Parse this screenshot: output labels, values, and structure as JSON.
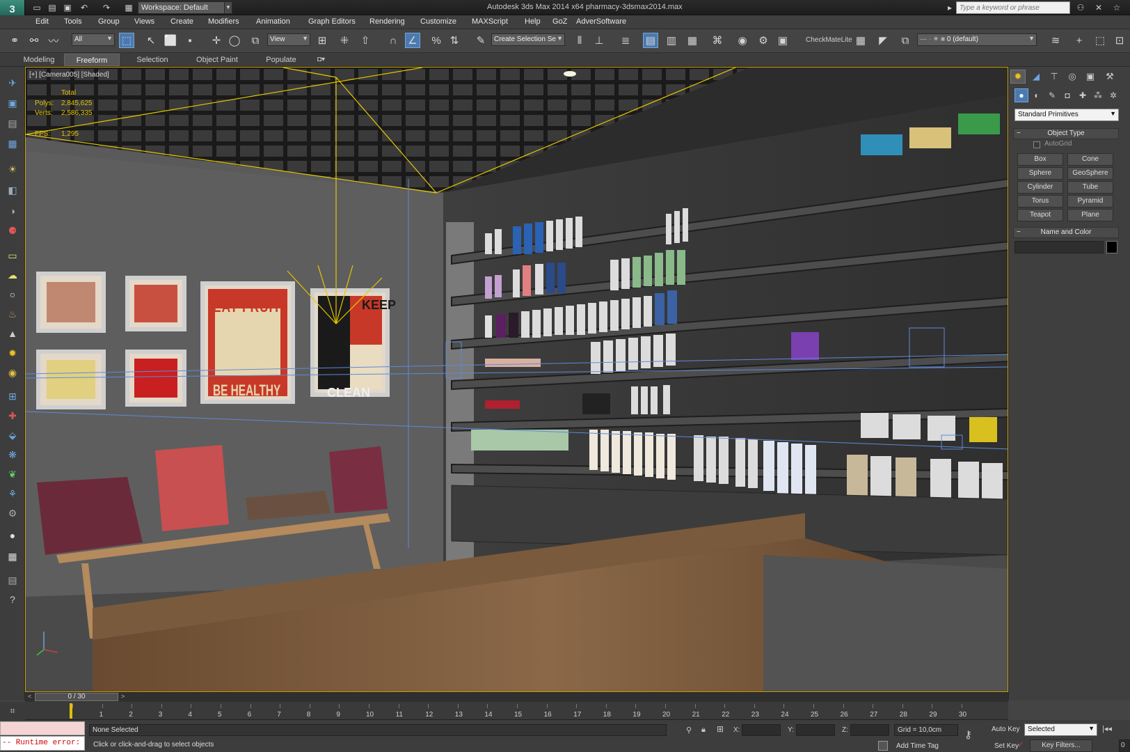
{
  "titlebar": {
    "app_title": "Autodesk 3ds Max  2014 x64      pharmacy-3dsmax2014.max",
    "workspace": "Workspace: Default",
    "search_placeholder": "Type a keyword or phrase"
  },
  "menus": [
    "Edit",
    "Tools",
    "Group",
    "Views",
    "Create",
    "Modifiers",
    "Animation",
    "Graph Editors",
    "Rendering",
    "Customize",
    "MAXScript",
    "Help",
    "GoZ",
    "AdverSoftware"
  ],
  "toolbar": {
    "selection_filter": "All",
    "ref_coord": "View",
    "named_selection": "Create Selection Se",
    "plugin_label": "CheckMateLite",
    "layer": "0 (default)"
  },
  "ribbon_tabs": [
    "Modeling",
    "Freeform",
    "Selection",
    "Object Paint",
    "Populate"
  ],
  "ribbon_active": "Freeform",
  "viewport": {
    "label": "[+] [Camera005] [Shaded]",
    "stats_header": "Total",
    "polys_label": "Polys:",
    "polys_value": "2,845,625",
    "verts_label": "Verts:",
    "verts_value": "2,586,335",
    "fps_label": "FPS:",
    "fps_value": "1,295",
    "poster_1": "EAT FRUIT",
    "poster_1b": "BE HEALTHY",
    "poster_2": "KEEP",
    "poster_2b": "CLEAN"
  },
  "command_panel": {
    "category": "Standard Primitives",
    "object_type_title": "Object Type",
    "autogrid": "AutoGrid",
    "primitives": [
      "Box",
      "Cone",
      "Sphere",
      "GeoSphere",
      "Cylinder",
      "Tube",
      "Torus",
      "Pyramid",
      "Teapot",
      "Plane"
    ],
    "name_color_title": "Name and Color"
  },
  "timeline": {
    "frame_display": "0 / 30",
    "ticks": [
      "0",
      "1",
      "2",
      "3",
      "4",
      "5",
      "6",
      "7",
      "8",
      "9",
      "10",
      "11",
      "12",
      "13",
      "14",
      "15",
      "16",
      "17",
      "18",
      "19",
      "20",
      "21",
      "22",
      "23",
      "24",
      "25",
      "26",
      "27",
      "28",
      "29",
      "30"
    ]
  },
  "status": {
    "runtime_error": "-- Runtime error:",
    "selection": "None Selected",
    "prompt": "Click or click-and-drag to select objects",
    "x_label": "X:",
    "y_label": "Y:",
    "z_label": "Z:",
    "grid": "Grid = 10,0cm",
    "add_time_tag": "Add Time Tag",
    "auto_key": "Auto Key",
    "set_key": "Set Key",
    "key_mode": "Selected",
    "key_filters": "Key Filters...",
    "frame_value": "0"
  },
  "colors": {
    "accent": "#4a7ab0",
    "viewport_border": "#c8a000",
    "stats": "#e6c300",
    "error": "#d00000"
  }
}
